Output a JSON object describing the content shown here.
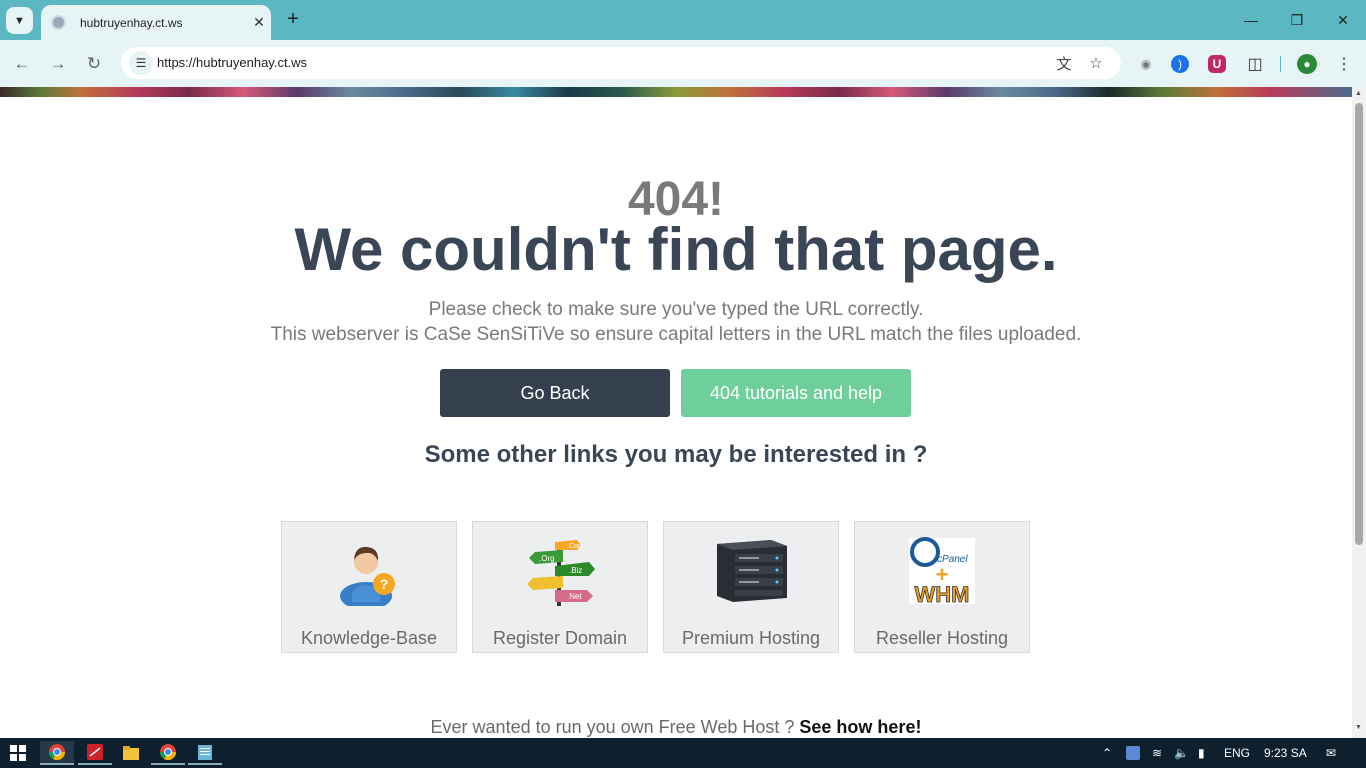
{
  "browser": {
    "tab_title": "hubtruyenhay.ct.ws",
    "new_tab_label": "+",
    "url": "https://hubtruyenhay.ct.ws"
  },
  "page": {
    "error_code": "404!",
    "headline": "We couldn't find that page.",
    "message_line1": "Please check to make sure you've typed the URL correctly.",
    "message_line2": "This webserver is CaSe SenSiTiVe so ensure capital letters in the URL match the files uploaded.",
    "go_back_label": "Go Back",
    "help_label": "404 tutorials and help",
    "other_links_heading": "Some other links you may be interested in ?",
    "cards": [
      {
        "label": "Knowledge-Base",
        "icon": "support-person-icon"
      },
      {
        "label": "Register Domain",
        "icon": "domain-signpost-icon",
        "signs": [
          ".Com",
          ".Org",
          ".Biz",
          ".Net"
        ]
      },
      {
        "label": "Premium Hosting",
        "icon": "server-icon"
      },
      {
        "label": "Reseller Hosting",
        "icon": "cpanel-whm-icon",
        "logo_text": [
          "cPanel",
          "+",
          "WHM"
        ]
      }
    ],
    "footer_text": "Ever wanted to run you own Free Web Host ?",
    "footer_link": "See how here!"
  },
  "taskbar": {
    "language": "ENG",
    "time": "9:23 SA"
  },
  "colors": {
    "tabbar": "#5bb8c3",
    "toolbar": "#e6f4f6",
    "headline": "#3a4656",
    "go_back_button": "#34404e",
    "help_button": "#6fcf9b",
    "taskbar": "#0e1f2e"
  }
}
